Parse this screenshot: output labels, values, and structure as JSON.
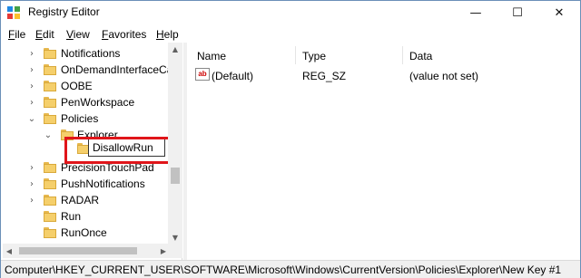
{
  "window": {
    "title": "Registry Editor"
  },
  "menu": [
    {
      "u": "F",
      "rest": "ile"
    },
    {
      "u": "E",
      "rest": "dit"
    },
    {
      "u": "V",
      "rest": "iew"
    },
    {
      "u": "F",
      "rest": "avorites"
    },
    {
      "u": "H",
      "rest": "elp"
    }
  ],
  "tree": {
    "items": [
      {
        "label": "Notifications"
      },
      {
        "label": "OnDemandInterfaceCa"
      },
      {
        "label": "OOBE"
      },
      {
        "label": "PenWorkspace"
      },
      {
        "label": "Policies"
      },
      {
        "label": "Explorer"
      },
      {
        "label": "DisallowRun"
      },
      {
        "label": "PrecisionTouchPad"
      },
      {
        "label": "PushNotifications"
      },
      {
        "label": "RADAR"
      },
      {
        "label": "Run"
      },
      {
        "label": "RunOnce"
      }
    ]
  },
  "values": {
    "headers": {
      "name": "Name",
      "type": "Type",
      "data": "Data"
    },
    "rows": [
      {
        "name": "(Default)",
        "type": "REG_SZ",
        "data": "(value not set)",
        "icon": "ab"
      }
    ]
  },
  "status": {
    "path": "Computer\\HKEY_CURRENT_USER\\SOFTWARE\\Microsoft\\Windows\\CurrentVersion\\Policies\\Explorer\\New Key #1"
  },
  "colors": {
    "highlight": "#e0151a",
    "folder": "#f5cf6b"
  }
}
